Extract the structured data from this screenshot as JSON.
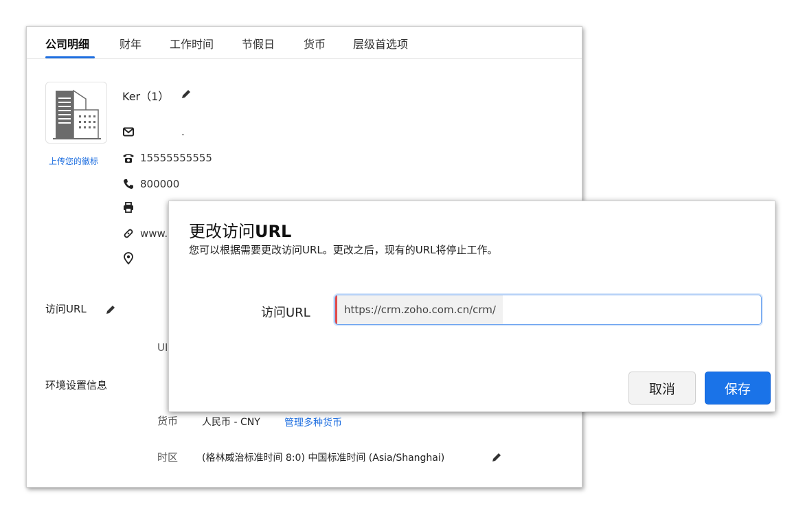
{
  "tabs": [
    {
      "label": "公司明细",
      "active": true
    },
    {
      "label": "财年"
    },
    {
      "label": "工作时间"
    },
    {
      "label": "节假日"
    },
    {
      "label": "货币"
    },
    {
      "label": "层级首选项"
    }
  ],
  "company": {
    "upload_logo_label": "上传您的徽标",
    "name": "Ker（1）",
    "email": ".",
    "phone": "15555555555",
    "mobile": "800000",
    "fax": "",
    "website": "www.l",
    "address": ""
  },
  "access_url_section": {
    "title": "访问URL",
    "partial_label": "UI"
  },
  "environment": {
    "title": "环境设置信息",
    "currency_label": "货币",
    "currency_value": "人民币 - CNY",
    "manage_currency_link": "管理多种货币",
    "timezone_label": "时区",
    "timezone_value": "(格林威治标准时间 8:0) 中国标准时间 (Asia/Shanghai)"
  },
  "dialog": {
    "title_prefix": "更改访问",
    "title_bold": "URL",
    "subtitle": "您可以根据需要更改访问URL。更改之后，现有的URL将停止工作。",
    "field_label": "访问URL",
    "url_prefix": "https://crm.zoho.com.cn/crm/",
    "url_value": "",
    "cancel_label": "取消",
    "save_label": "保存"
  },
  "colors": {
    "accent": "#1a73e8",
    "link": "#1f6fe0",
    "error_marker": "#e04a4a"
  },
  "icons": [
    "building-icon",
    "edit-pencil-icon",
    "mail-icon",
    "phone-icon",
    "mobile-icon",
    "fax-icon",
    "link-icon",
    "location-icon"
  ]
}
